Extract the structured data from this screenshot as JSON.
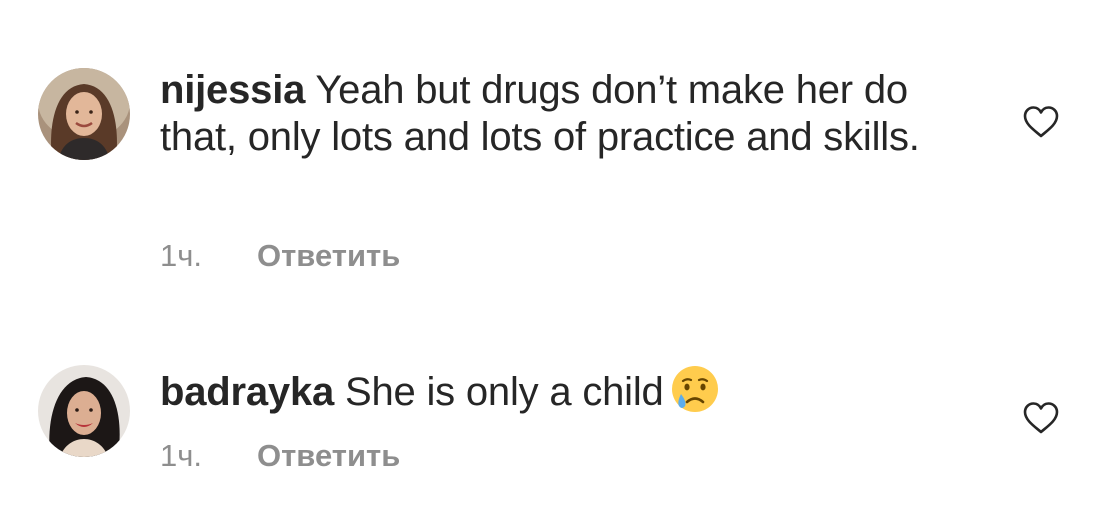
{
  "comments": [
    {
      "username": "nijessia",
      "text": "Yeah but drugs don’t make her do that, only lots and lots of practice and skills.",
      "time": "1ч.",
      "reply_label": "Ответить",
      "avatar_icon": "profile-photo-woman-smiling",
      "like_icon": "heart-outline-icon"
    },
    {
      "username": "badrayka",
      "text": "She is only a child",
      "emoji": "crying-face-emoji",
      "time": "1ч.",
      "reply_label": "Ответить",
      "avatar_icon": "profile-photo-woman-smiling",
      "like_icon": "heart-outline-icon"
    }
  ],
  "colors": {
    "text": "#262626",
    "secondary": "#8e8e8e",
    "background": "#ffffff",
    "emoji_face": "#ffcc4d",
    "emoji_tear": "#5dadec"
  }
}
